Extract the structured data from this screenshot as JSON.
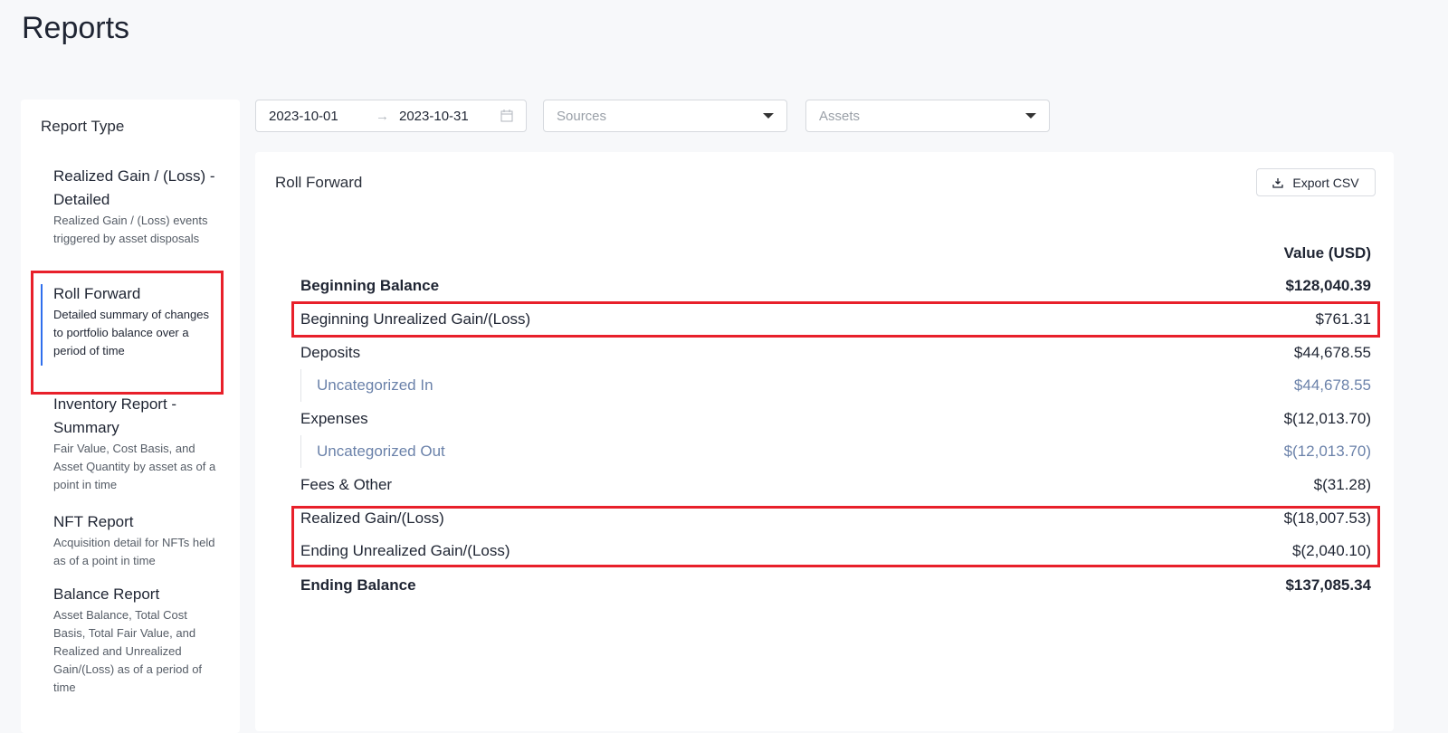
{
  "page_title": "Reports",
  "sidebar": {
    "heading": "Report Type",
    "items": [
      {
        "name": "Realized Gain / (Loss) - Detailed",
        "desc": "Realized Gain / (Loss) events triggered by asset disposals"
      },
      {
        "name": "Roll Forward",
        "desc": "Detailed summary of changes to portfolio balance over a period of time"
      },
      {
        "name": "Inventory Report - Summary",
        "desc": "Fair Value, Cost Basis, and Asset Quantity by asset as of a point in time"
      },
      {
        "name": "NFT Report",
        "desc": "Acquisition detail for NFTs held as of a point in time"
      },
      {
        "name": "Balance Report",
        "desc": "Asset Balance, Total Cost Basis, Total Fair Value, and Realized and Unrealized Gain/(Loss) as of a period of time"
      }
    ]
  },
  "filters": {
    "start_date": "2023-10-01",
    "arrow": "→",
    "end_date": "2023-10-31",
    "sources_placeholder": "Sources",
    "assets_placeholder": "Assets"
  },
  "report": {
    "title": "Roll Forward",
    "export_label": "Export CSV",
    "value_header": "Value (USD)",
    "rows": [
      {
        "label": "Beginning Balance",
        "value": "$128,040.39"
      },
      {
        "label": "Beginning Unrealized Gain/(Loss)",
        "value": "$761.31"
      },
      {
        "label": "Deposits",
        "value": "$44,678.55"
      },
      {
        "label": "Uncategorized In",
        "value": "$44,678.55"
      },
      {
        "label": "Expenses",
        "value": "$(12,013.70)"
      },
      {
        "label": "Uncategorized Out",
        "value": "$(12,013.70)"
      },
      {
        "label": "Fees & Other",
        "value": "$(31.28)"
      },
      {
        "label": "Realized Gain/(Loss)",
        "value": "$(18,007.53)"
      },
      {
        "label": "Ending Unrealized Gain/(Loss)",
        "value": "$(2,040.10)"
      },
      {
        "label": "Ending Balance",
        "value": "$137,085.34"
      }
    ]
  },
  "colors": {
    "accent": "#2f6fed",
    "highlight": "#e8202a",
    "sub_text": "#6b82aa"
  }
}
